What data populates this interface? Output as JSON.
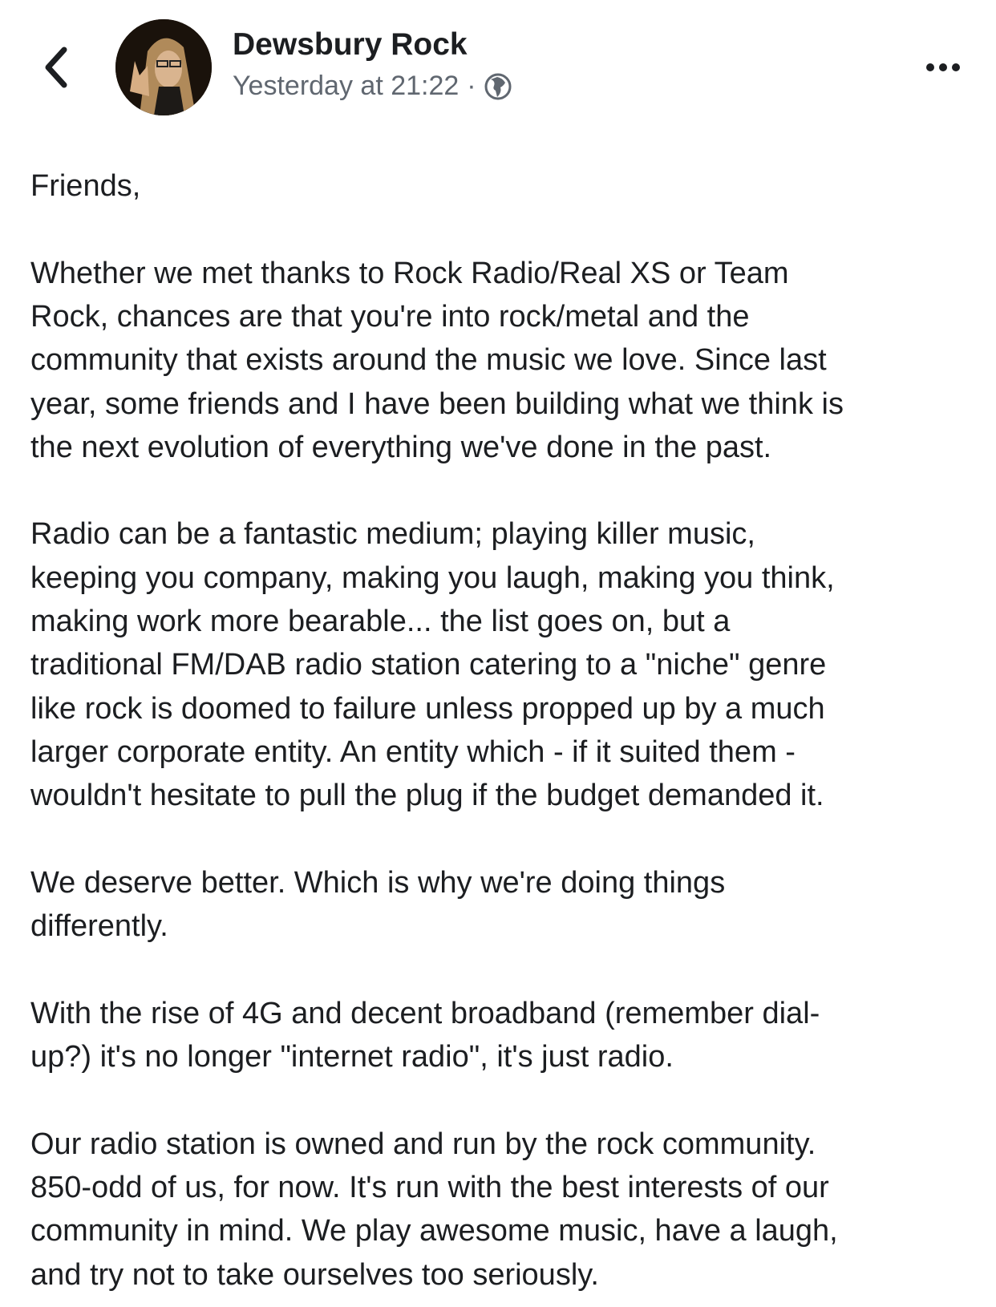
{
  "header": {
    "author": "Dewsbury Rock",
    "timestamp": "Yesterday at 21:22",
    "separator": "·",
    "audience_icon": "globe-icon",
    "back_icon": "chevron-left-icon",
    "more_icon": "more-horizontal-icon"
  },
  "post": {
    "paragraphs": [
      [
        "Friends,"
      ],
      [
        "Whether we met thanks to Rock Radio/Real XS or Team",
        "Rock, chances are that you're into rock/metal and the",
        "community that exists around the music we love. Since last",
        "year, some friends and I have been building what we think is",
        "the next evolution of everything we've done in the past."
      ],
      [
        "Radio can be a fantastic medium; playing killer music,",
        "keeping you company, making you laugh, making you think,",
        "making work more bearable... the list goes on, but a",
        "traditional FM/DAB radio station catering to a \"niche\" genre",
        "like rock is doomed to failure unless propped up by a much",
        "larger corporate entity. An entity which - if it suited them -",
        "wouldn't hesitate to pull the plug if the budget demanded it."
      ],
      [
        "We deserve better. Which is why we're doing things",
        "differently."
      ],
      [
        "With the rise of 4G and decent broadband (remember dial-",
        "up?) it's no longer \"internet radio\", it's just radio."
      ],
      [
        "Our radio station is owned and run by the rock community.",
        "850-odd of us, for now. It's run with the best interests of our",
        "community in mind. We play awesome music, have a laugh,",
        "and try not to take ourselves too seriously."
      ]
    ]
  }
}
